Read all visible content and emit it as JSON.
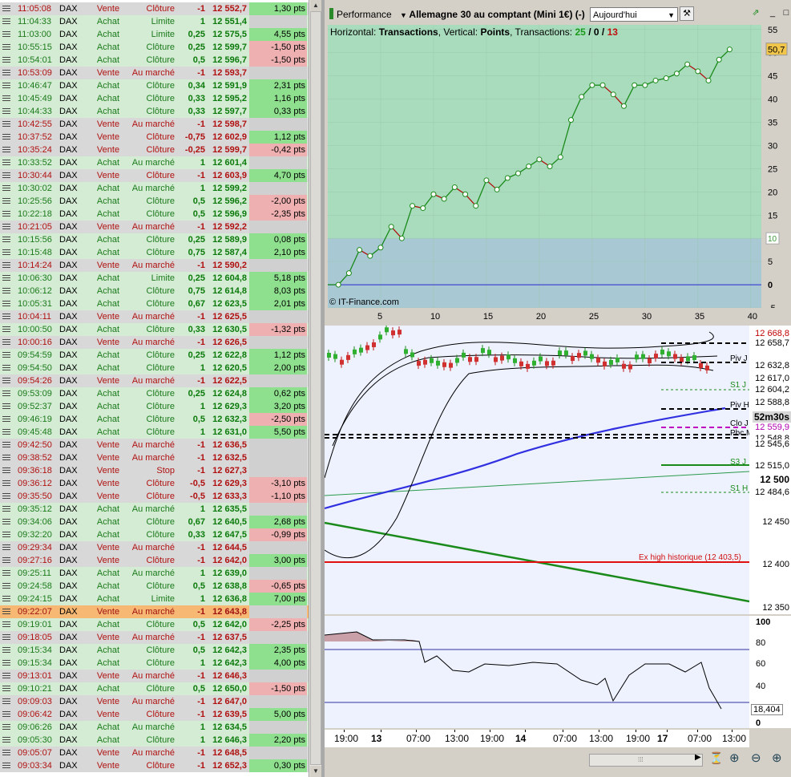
{
  "orders": [
    {
      "time": "11:05:08",
      "inst": "DAX",
      "side": "Vente",
      "type": "Clôture",
      "qty": "-1",
      "price": "12 552,7",
      "pts": "1,30 pts",
      "pk": "pos"
    },
    {
      "time": "11:04:33",
      "inst": "DAX",
      "side": "Achat",
      "type": "Limite",
      "qty": "1",
      "price": "12 551,4",
      "pts": "",
      "pk": "none"
    },
    {
      "time": "11:03:00",
      "inst": "DAX",
      "side": "Achat",
      "type": "Limite",
      "qty": "0,25",
      "price": "12 575,5",
      "pts": "4,55 pts",
      "pk": "pos"
    },
    {
      "time": "10:55:15",
      "inst": "DAX",
      "side": "Achat",
      "type": "Clôture",
      "qty": "0,25",
      "price": "12 599,7",
      "pts": "-1,50 pts",
      "pk": "neg"
    },
    {
      "time": "10:54:01",
      "inst": "DAX",
      "side": "Achat",
      "type": "Clôture",
      "qty": "0,5",
      "price": "12 596,7",
      "pts": "-1,50 pts",
      "pk": "neg"
    },
    {
      "time": "10:53:09",
      "inst": "DAX",
      "side": "Vente",
      "type": "Au marché",
      "qty": "-1",
      "price": "12 593,7",
      "pts": "",
      "pk": "none"
    },
    {
      "time": "10:46:47",
      "inst": "DAX",
      "side": "Achat",
      "type": "Clôture",
      "qty": "0,34",
      "price": "12 591,9",
      "pts": "2,31 pts",
      "pk": "pos"
    },
    {
      "time": "10:45:49",
      "inst": "DAX",
      "side": "Achat",
      "type": "Clôture",
      "qty": "0,33",
      "price": "12 595,2",
      "pts": "1,16 pts",
      "pk": "pos"
    },
    {
      "time": "10:44:33",
      "inst": "DAX",
      "side": "Achat",
      "type": "Clôture",
      "qty": "0,33",
      "price": "12 597,7",
      "pts": "0,33 pts",
      "pk": "pos"
    },
    {
      "time": "10:42:55",
      "inst": "DAX",
      "side": "Vente",
      "type": "Au marché",
      "qty": "-1",
      "price": "12 598,7",
      "pts": "",
      "pk": "none"
    },
    {
      "time": "10:37:52",
      "inst": "DAX",
      "side": "Vente",
      "type": "Clôture",
      "qty": "-0,75",
      "price": "12 602,9",
      "pts": "1,12 pts",
      "pk": "pos"
    },
    {
      "time": "10:35:24",
      "inst": "DAX",
      "side": "Vente",
      "type": "Clôture",
      "qty": "-0,25",
      "price": "12 599,7",
      "pts": "-0,42 pts",
      "pk": "neg"
    },
    {
      "time": "10:33:52",
      "inst": "DAX",
      "side": "Achat",
      "type": "Au marché",
      "qty": "1",
      "price": "12 601,4",
      "pts": "",
      "pk": "none"
    },
    {
      "time": "10:30:44",
      "inst": "DAX",
      "side": "Vente",
      "type": "Clôture",
      "qty": "-1",
      "price": "12 603,9",
      "pts": "4,70 pts",
      "pk": "pos"
    },
    {
      "time": "10:30:02",
      "inst": "DAX",
      "side": "Achat",
      "type": "Au marché",
      "qty": "1",
      "price": "12 599,2",
      "pts": "",
      "pk": "none"
    },
    {
      "time": "10:25:56",
      "inst": "DAX",
      "side": "Achat",
      "type": "Clôture",
      "qty": "0,5",
      "price": "12 596,2",
      "pts": "-2,00 pts",
      "pk": "neg"
    },
    {
      "time": "10:22:18",
      "inst": "DAX",
      "side": "Achat",
      "type": "Clôture",
      "qty": "0,5",
      "price": "12 596,9",
      "pts": "-2,35 pts",
      "pk": "neg"
    },
    {
      "time": "10:21:05",
      "inst": "DAX",
      "side": "Vente",
      "type": "Au marché",
      "qty": "-1",
      "price": "12 592,2",
      "pts": "",
      "pk": "none"
    },
    {
      "time": "10:15:56",
      "inst": "DAX",
      "side": "Achat",
      "type": "Clôture",
      "qty": "0,25",
      "price": "12 589,9",
      "pts": "0,08 pts",
      "pk": "pos"
    },
    {
      "time": "10:15:48",
      "inst": "DAX",
      "side": "Achat",
      "type": "Clôture",
      "qty": "0,75",
      "price": "12 587,4",
      "pts": "2,10 pts",
      "pk": "pos"
    },
    {
      "time": "10:14:24",
      "inst": "DAX",
      "side": "Vente",
      "type": "Au marché",
      "qty": "-1",
      "price": "12 590,2",
      "pts": "",
      "pk": "none"
    },
    {
      "time": "10:06:30",
      "inst": "DAX",
      "side": "Achat",
      "type": "Limite",
      "qty": "0,25",
      "price": "12 604,8",
      "pts": "5,18 pts",
      "pk": "pos"
    },
    {
      "time": "10:06:12",
      "inst": "DAX",
      "side": "Achat",
      "type": "Clôture",
      "qty": "0,75",
      "price": "12 614,8",
      "pts": "8,03 pts",
      "pk": "pos"
    },
    {
      "time": "10:05:31",
      "inst": "DAX",
      "side": "Achat",
      "type": "Clôture",
      "qty": "0,67",
      "price": "12 623,5",
      "pts": "2,01 pts",
      "pk": "pos"
    },
    {
      "time": "10:04:11",
      "inst": "DAX",
      "side": "Vente",
      "type": "Au marché",
      "qty": "-1",
      "price": "12 625,5",
      "pts": "",
      "pk": "none"
    },
    {
      "time": "10:00:50",
      "inst": "DAX",
      "side": "Achat",
      "type": "Clôture",
      "qty": "0,33",
      "price": "12 630,5",
      "pts": "-1,32 pts",
      "pk": "neg"
    },
    {
      "time": "10:00:16",
      "inst": "DAX",
      "side": "Vente",
      "type": "Au marché",
      "qty": "-1",
      "price": "12 626,5",
      "pts": "",
      "pk": "none"
    },
    {
      "time": "09:54:59",
      "inst": "DAX",
      "side": "Achat",
      "type": "Clôture",
      "qty": "0,25",
      "price": "12 622,8",
      "pts": "1,12 pts",
      "pk": "pos"
    },
    {
      "time": "09:54:50",
      "inst": "DAX",
      "side": "Achat",
      "type": "Clôture",
      "qty": "1",
      "price": "12 620,5",
      "pts": "2,00 pts",
      "pk": "pos"
    },
    {
      "time": "09:54:26",
      "inst": "DAX",
      "side": "Vente",
      "type": "Au marché",
      "qty": "-1",
      "price": "12 622,5",
      "pts": "",
      "pk": "none"
    },
    {
      "time": "09:53:09",
      "inst": "DAX",
      "side": "Achat",
      "type": "Clôture",
      "qty": "0,25",
      "price": "12 624,8",
      "pts": "0,62 pts",
      "pk": "pos"
    },
    {
      "time": "09:52:37",
      "inst": "DAX",
      "side": "Achat",
      "type": "Clôture",
      "qty": "1",
      "price": "12 629,3",
      "pts": "3,20 pts",
      "pk": "pos"
    },
    {
      "time": "09:46:19",
      "inst": "DAX",
      "side": "Achat",
      "type": "Clôture",
      "qty": "0,5",
      "price": "12 632,3",
      "pts": "-2,50 pts",
      "pk": "neg"
    },
    {
      "time": "09:45:48",
      "inst": "DAX",
      "side": "Achat",
      "type": "Clôture",
      "qty": "1",
      "price": "12 631,0",
      "pts": "5,50 pts",
      "pk": "pos"
    },
    {
      "time": "09:42:50",
      "inst": "DAX",
      "side": "Vente",
      "type": "Au marché",
      "qty": "-1",
      "price": "12 636,5",
      "pts": "",
      "pk": "none"
    },
    {
      "time": "09:38:52",
      "inst": "DAX",
      "side": "Vente",
      "type": "Au marché",
      "qty": "-1",
      "price": "12 632,5",
      "pts": "",
      "pk": "none"
    },
    {
      "time": "09:36:18",
      "inst": "DAX",
      "side": "Vente",
      "type": "Stop",
      "qty": "-1",
      "price": "12 627,3",
      "pts": "",
      "pk": "none"
    },
    {
      "time": "09:36:12",
      "inst": "DAX",
      "side": "Vente",
      "type": "Clôture",
      "qty": "-0,5",
      "price": "12 629,3",
      "pts": "-3,10 pts",
      "pk": "neg"
    },
    {
      "time": "09:35:50",
      "inst": "DAX",
      "side": "Vente",
      "type": "Clôture",
      "qty": "-0,5",
      "price": "12 633,3",
      "pts": "-1,10 pts",
      "pk": "neg"
    },
    {
      "time": "09:35:12",
      "inst": "DAX",
      "side": "Achat",
      "type": "Au marché",
      "qty": "1",
      "price": "12 635,5",
      "pts": "",
      "pk": "none"
    },
    {
      "time": "09:34:06",
      "inst": "DAX",
      "side": "Achat",
      "type": "Clôture",
      "qty": "0,67",
      "price": "12 640,5",
      "pts": "2,68 pts",
      "pk": "pos"
    },
    {
      "time": "09:32:20",
      "inst": "DAX",
      "side": "Achat",
      "type": "Clôture",
      "qty": "0,33",
      "price": "12 647,5",
      "pts": "-0,99 pts",
      "pk": "neg"
    },
    {
      "time": "09:29:34",
      "inst": "DAX",
      "side": "Vente",
      "type": "Au marché",
      "qty": "-1",
      "price": "12 644,5",
      "pts": "",
      "pk": "none"
    },
    {
      "time": "09:27:16",
      "inst": "DAX",
      "side": "Vente",
      "type": "Clôture",
      "qty": "-1",
      "price": "12 642,0",
      "pts": "3,00 pts",
      "pk": "pos"
    },
    {
      "time": "09:25:11",
      "inst": "DAX",
      "side": "Achat",
      "type": "Au marché",
      "qty": "1",
      "price": "12 639,0",
      "pts": "",
      "pk": "none"
    },
    {
      "time": "09:24:58",
      "inst": "DAX",
      "side": "Achat",
      "type": "Clôture",
      "qty": "0,5",
      "price": "12 638,8",
      "pts": "-0,65 pts",
      "pk": "neg"
    },
    {
      "time": "09:24:15",
      "inst": "DAX",
      "side": "Achat",
      "type": "Limite",
      "qty": "1",
      "price": "12 636,8",
      "pts": "7,00 pts",
      "pk": "pos"
    },
    {
      "time": "09:22:07",
      "inst": "DAX",
      "side": "Vente",
      "type": "Au marché",
      "qty": "-1",
      "price": "12 643,8",
      "pts": "",
      "pk": "none",
      "hl": true
    },
    {
      "time": "09:19:01",
      "inst": "DAX",
      "side": "Achat",
      "type": "Clôture",
      "qty": "0,5",
      "price": "12 642,0",
      "pts": "-2,25 pts",
      "pk": "neg"
    },
    {
      "time": "09:18:05",
      "inst": "DAX",
      "side": "Vente",
      "type": "Au marché",
      "qty": "-1",
      "price": "12 637,5",
      "pts": "",
      "pk": "none"
    },
    {
      "time": "09:15:34",
      "inst": "DAX",
      "side": "Achat",
      "type": "Clôture",
      "qty": "0,5",
      "price": "12 642,3",
      "pts": "2,35 pts",
      "pk": "pos"
    },
    {
      "time": "09:15:34",
      "inst": "DAX",
      "side": "Achat",
      "type": "Clôture",
      "qty": "1",
      "price": "12 642,3",
      "pts": "4,00 pts",
      "pk": "pos"
    },
    {
      "time": "09:13:01",
      "inst": "DAX",
      "side": "Vente",
      "type": "Au marché",
      "qty": "-1",
      "price": "12 646,3",
      "pts": "",
      "pk": "none"
    },
    {
      "time": "09:10:21",
      "inst": "DAX",
      "side": "Achat",
      "type": "Clôture",
      "qty": "0,5",
      "price": "12 650,0",
      "pts": "-1,50 pts",
      "pk": "neg"
    },
    {
      "time": "09:09:03",
      "inst": "DAX",
      "side": "Vente",
      "type": "Au marché",
      "qty": "-1",
      "price": "12 647,0",
      "pts": "",
      "pk": "none"
    },
    {
      "time": "09:06:42",
      "inst": "DAX",
      "side": "Vente",
      "type": "Clôture",
      "qty": "-1",
      "price": "12 639,5",
      "pts": "5,00 pts",
      "pk": "pos"
    },
    {
      "time": "09:06:26",
      "inst": "DAX",
      "side": "Achat",
      "type": "Au marché",
      "qty": "1",
      "price": "12 634,5",
      "pts": "",
      "pk": "none"
    },
    {
      "time": "09:05:30",
      "inst": "DAX",
      "side": "Achat",
      "type": "Clôture",
      "qty": "1",
      "price": "12 646,3",
      "pts": "2,20 pts",
      "pk": "pos"
    },
    {
      "time": "09:05:07",
      "inst": "DAX",
      "side": "Vente",
      "type": "Au marché",
      "qty": "-1",
      "price": "12 648,5",
      "pts": "",
      "pk": "none"
    },
    {
      "time": "09:03:34",
      "inst": "DAX",
      "side": "Vente",
      "type": "Clôture",
      "qty": "-1",
      "price": "12 652,3",
      "pts": "0,30 pts",
      "pk": "pos"
    }
  ],
  "toolbar": {
    "performance_label": "Performance",
    "instrument_label": "Allemagne 30 au comptant (Mini 1€) (-)",
    "period_value": "Aujourd'hui"
  },
  "perf": {
    "horizontal_label": "Horizontal:",
    "horizontal_value": "Transactions",
    "vertical_label": ", Vertical:",
    "vertical_value": "Points",
    "transactions_label": ", Transactions:",
    "tx_win": "25",
    "tx_sep1": " / ",
    "tx_even": "0",
    "tx_sep2": " / ",
    "tx_loss": "13",
    "copyright": "© IT-Finance.com",
    "current_value_tag": "50,7",
    "threshold_tag": "10",
    "y_ticks": [
      "55",
      "50",
      "45",
      "40",
      "35",
      "30",
      "25",
      "20",
      "15",
      "10",
      "5",
      "0",
      "-5"
    ],
    "x_ticks": [
      "5",
      "10",
      "15",
      "20",
      "25",
      "30",
      "35",
      "40"
    ],
    "colors": {
      "up": "#1a8a1a",
      "down": "#b01010",
      "bg_top": "#a8dcbc",
      "bg_low": "#a8c8d4"
    }
  },
  "chart_data": {
    "type": "line",
    "title": "",
    "xlabel": "Transactions",
    "ylabel": "Points",
    "xlim": [
      0,
      41
    ],
    "ylim": [
      -5,
      56
    ],
    "x": [
      0,
      1,
      2,
      3,
      4,
      5,
      6,
      7,
      8,
      9,
      10,
      11,
      12,
      13,
      14,
      15,
      16,
      17,
      18,
      19,
      20,
      21,
      22,
      23,
      24,
      25,
      26,
      27,
      28,
      29,
      30,
      31,
      32,
      33,
      34,
      35,
      36,
      37,
      38
    ],
    "values": [
      0,
      0,
      2.5,
      7.5,
      6.2,
      8,
      12.5,
      10,
      17,
      16.5,
      19.5,
      18.5,
      21,
      19.5,
      17,
      22.5,
      20.5,
      23,
      24,
      25.5,
      27,
      25.5,
      27.5,
      35.5,
      40.5,
      43,
      43,
      41,
      38.5,
      43,
      43,
      44,
      44.5,
      45.5,
      47.5,
      46,
      44,
      48.5,
      50.7
    ]
  },
  "price": {
    "tags": [
      {
        "label": "12 668,8",
        "color": "#c00000",
        "bg": "#ffffff"
      },
      {
        "label": "12 658,7",
        "color": "#000",
        "bg": "#ffffff"
      },
      {
        "label": "12 632,8",
        "color": "#000",
        "bg": "#ffffff"
      },
      {
        "label": "12 617,0",
        "color": "#000",
        "bg": "#ffffff"
      },
      {
        "label": "12 604,2",
        "color": "#000",
        "bg": "#ffffff"
      },
      {
        "label": "12 588,8",
        "color": "#000",
        "bg": "#ffffff"
      },
      {
        "label": "52m30s",
        "color": "#000",
        "bg": "#d8d8d8"
      },
      {
        "label": "12 559,9",
        "color": "#b000b0",
        "bg": "#ffffff"
      },
      {
        "label": "12 548,8",
        "color": "#000",
        "bg": "#ffffff"
      },
      {
        "label": "12 545,6",
        "color": "#000",
        "bg": "#ffffff"
      },
      {
        "label": "12 515,0",
        "color": "#000",
        "bg": "#ffffff"
      },
      {
        "label": "12 500",
        "color": "#000",
        "bg": "#ffffff"
      },
      {
        "label": "12 484,6",
        "color": "#000",
        "bg": "#ffffff"
      },
      {
        "label": "12 450",
        "color": "#000",
        "bg": "#ffffff"
      },
      {
        "label": "12 400",
        "color": "#000",
        "bg": "#ffffff"
      },
      {
        "label": "12 350",
        "color": "#000",
        "bg": "#ffffff"
      }
    ],
    "level_labels": [
      "Piv J",
      "S1 J",
      "Piv H",
      "Clo J",
      "Pbc M",
      "S3 J",
      "S1 H"
    ],
    "ex_high_label": "Ex high historique (12 403,5)"
  },
  "rsi": {
    "ticks": [
      "100",
      "80",
      "60",
      "40",
      "18,404",
      "0"
    ]
  },
  "time_axis": [
    "19:00",
    "13",
    "07:00",
    "13:00",
    "19:00",
    "14",
    "07:00",
    "13:00",
    "19:00",
    "17",
    "07:00",
    "13:00"
  ]
}
